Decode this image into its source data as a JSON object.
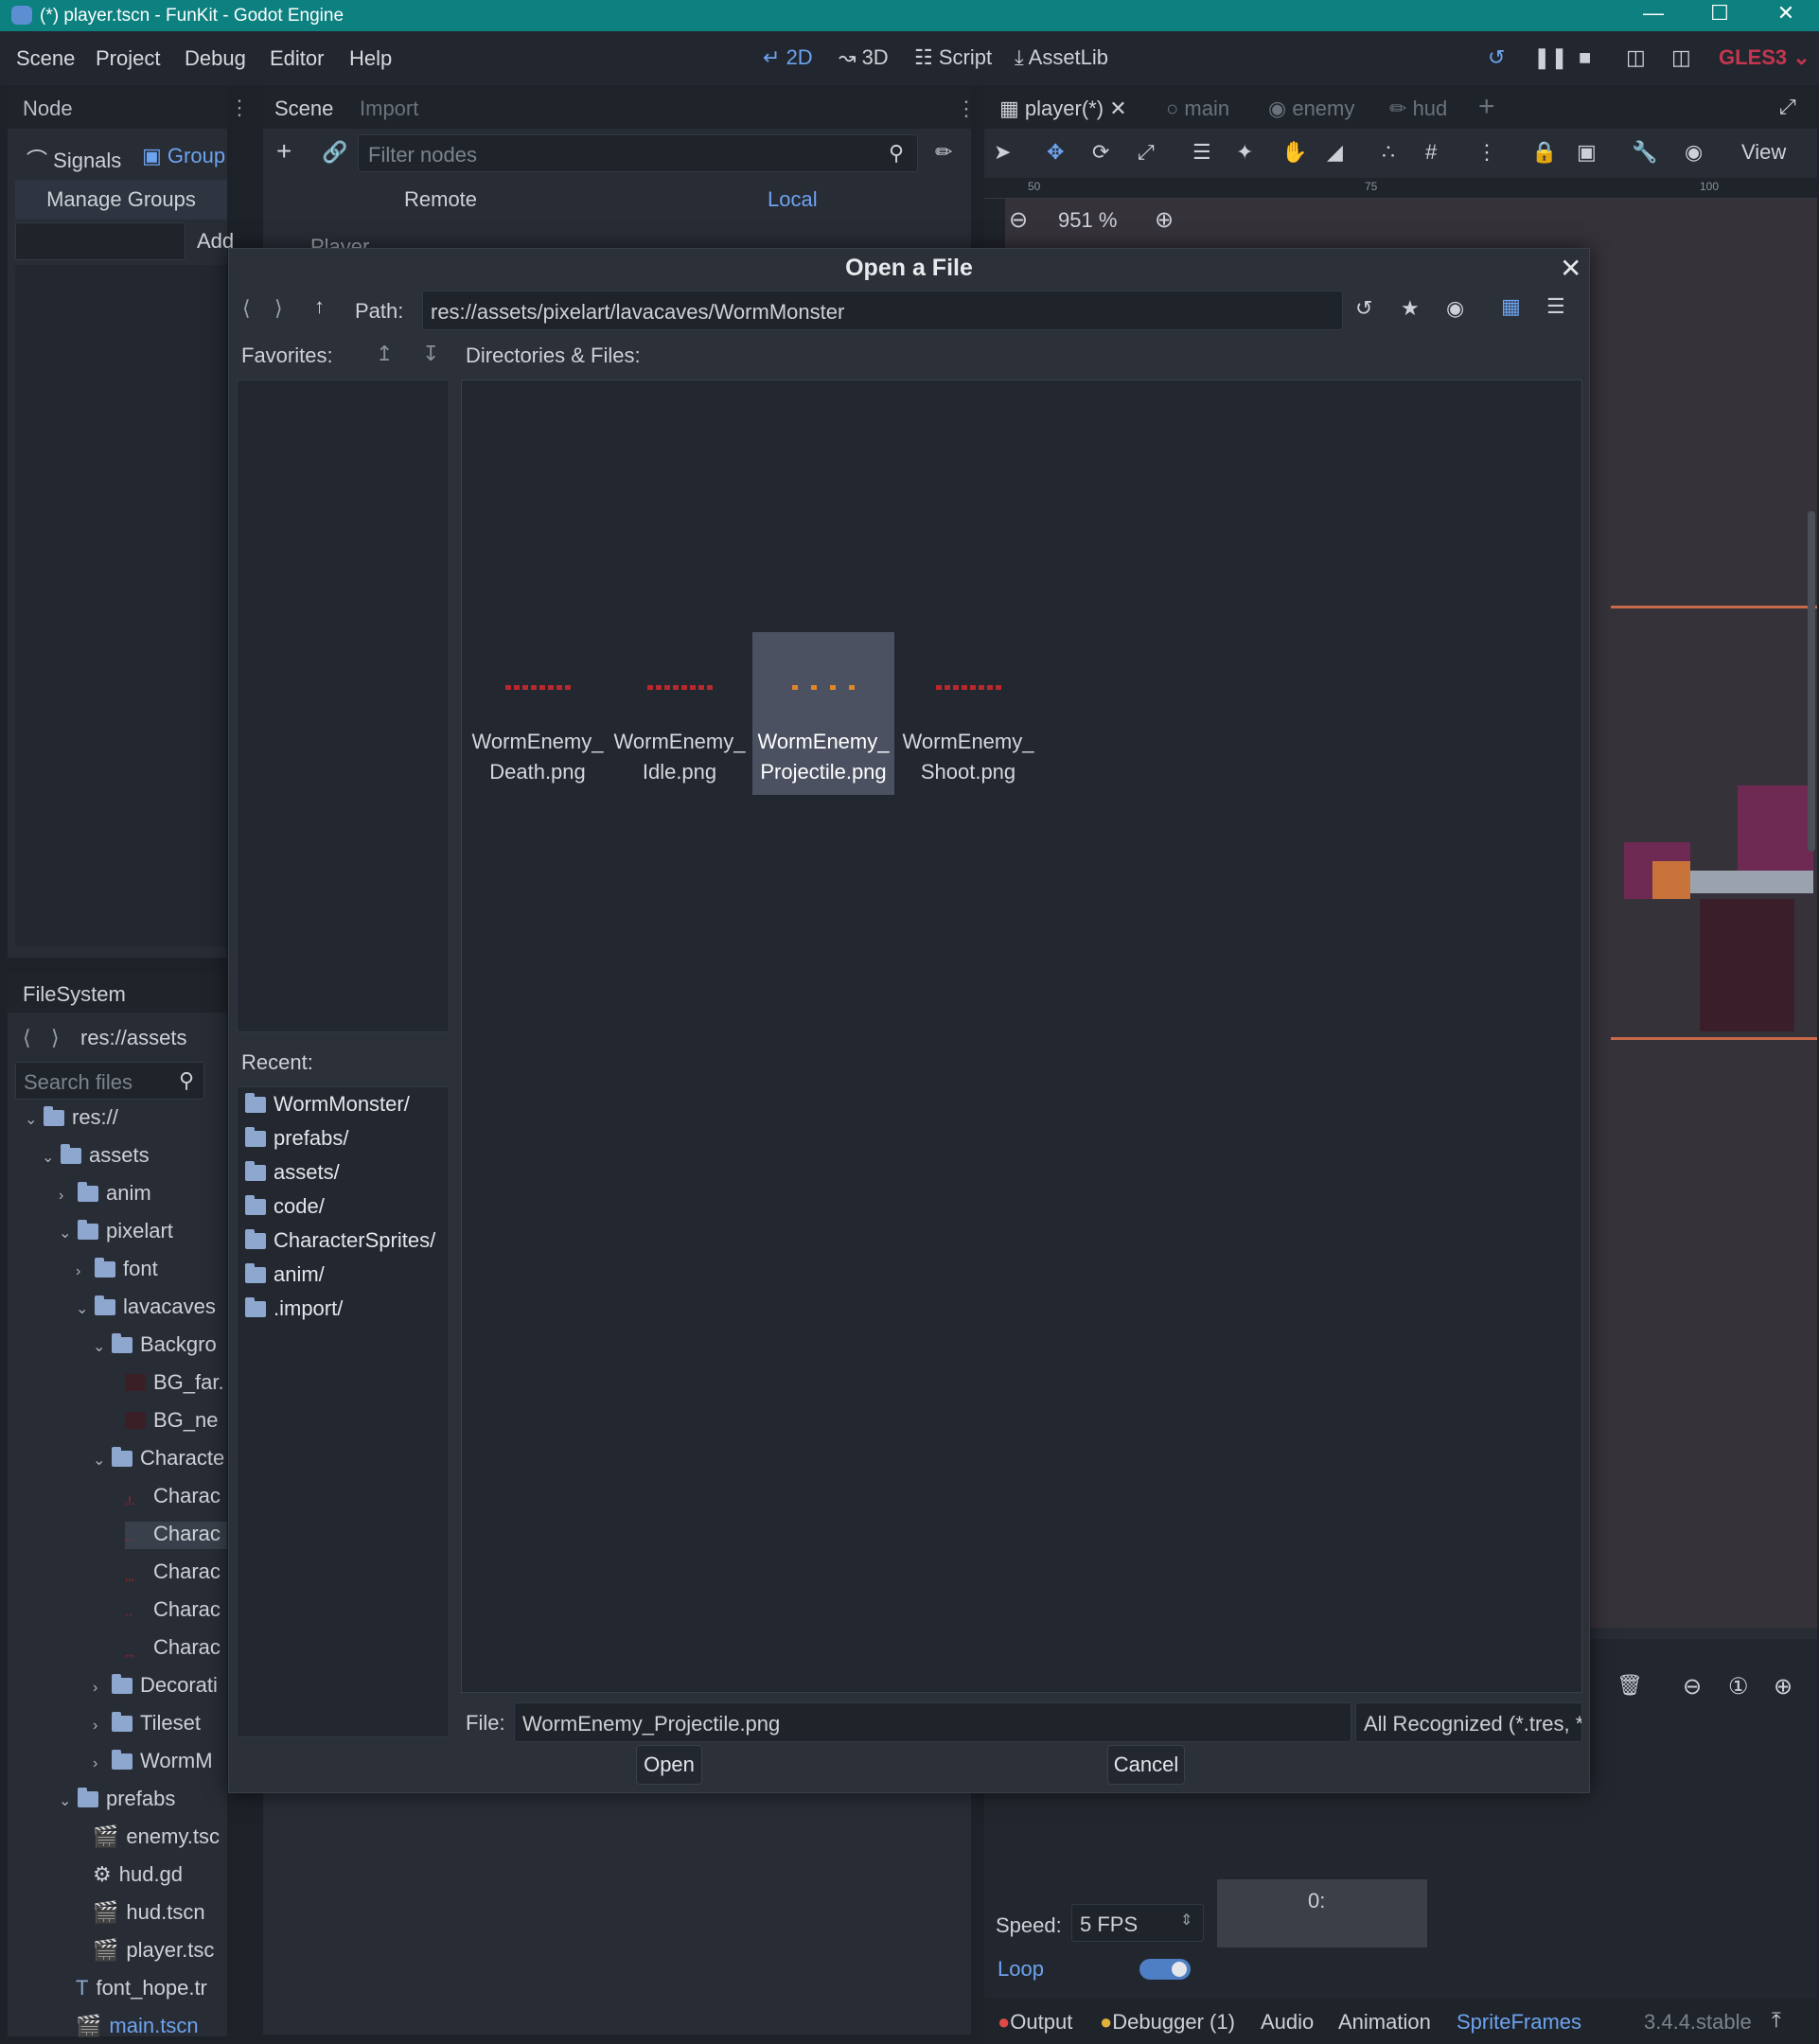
{
  "window": {
    "title": "(*) player.tscn - FunKit - Godot Engine"
  },
  "menubar": {
    "menus": [
      "Scene",
      "Project",
      "Debug",
      "Editor",
      "Help"
    ],
    "workspaces": [
      "2D",
      "3D",
      "Script",
      "AssetLib"
    ],
    "renderer": "GLES3"
  },
  "node_dock": {
    "tab": "Node",
    "signals_label": "Signals",
    "group_label": "Group",
    "manage_groups": "Manage Groups",
    "add_label": "Add"
  },
  "scene_dock": {
    "tabs": [
      "Scene",
      "Import"
    ],
    "filter_placeholder": "Filter nodes",
    "remote_label": "Remote",
    "local_label": "Local",
    "root_node": "Player"
  },
  "filesystem": {
    "tab": "FileSystem",
    "path": "res://assets",
    "search_placeholder": "Search files",
    "items": [
      "res://",
      "assets",
      "anim",
      "pixelart",
      "font",
      "lavacaves",
      "Backgro",
      "BG_far.",
      "BG_ne",
      "Characte",
      "Charac",
      "Charac",
      "Charac",
      "Charac",
      "Charac",
      "Decorati",
      "Tileset",
      "WormM",
      "prefabs",
      "enemy.tsc",
      "hud.gd",
      "hud.tscn",
      "player.tsc",
      "font_hope.tr",
      "main.tscn"
    ]
  },
  "editor": {
    "tabs": [
      "player(*)",
      "main",
      "enemy",
      "hud"
    ],
    "view_label": "View",
    "zoom": "951 %",
    "ruler_marks": [
      "50",
      "75",
      "100"
    ]
  },
  "spriteframes": {
    "frame_label": "0:",
    "speed_label": "Speed:",
    "speed_value": "5 FPS",
    "loop_label": "Loop"
  },
  "bottom_tabs": [
    "Output",
    "Debugger (1)",
    "Audio",
    "Animation",
    "SpriteFrames"
  ],
  "version": "3.4.4.stable",
  "dialog": {
    "title": "Open a File",
    "path_label": "Path:",
    "path_value": "res://assets/pixelart/lavacaves/WormMonster",
    "favorites_label": "Favorites:",
    "dirs_files_label": "Directories & Files:",
    "recent_label": "Recent:",
    "recent": [
      "WormMonster/",
      "prefabs/",
      "assets/",
      "code/",
      "CharacterSprites/",
      "anim/",
      ".import/"
    ],
    "files": [
      {
        "line1": "WormEnemy_",
        "line2": "Death.png"
      },
      {
        "line1": "WormEnemy_",
        "line2": "Idle.png"
      },
      {
        "line1": "WormEnemy_",
        "line2": "Projectile.png"
      },
      {
        "line1": "WormEnemy_",
        "line2": "Shoot.png"
      }
    ],
    "file_label": "File:",
    "file_value": "WormEnemy_Projectile.png",
    "filter_value": "All Recognized (*.tres, *.atlastex, *.curvetex,",
    "open_label": "Open",
    "cancel_label": "Cancel"
  }
}
